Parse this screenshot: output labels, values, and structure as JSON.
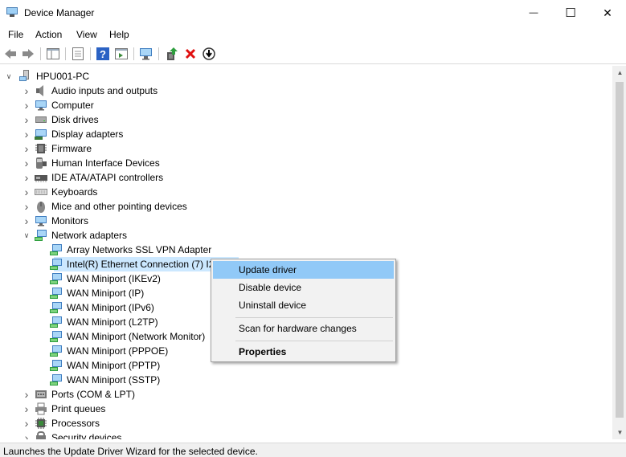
{
  "window": {
    "title": "Device Manager",
    "minimize_glyph": "—",
    "maximize_glyph": "☐",
    "close_glyph": "✕"
  },
  "menu": [
    "File",
    "Action",
    "View",
    "Help"
  ],
  "toolbar": {
    "buttons": [
      "back-icon",
      "forward-icon",
      "show-hide-tree-icon",
      "properties-icon",
      "help-icon",
      "action-pane-icon",
      "scan-hardware-icon",
      "update-driver-icon",
      "uninstall-icon",
      "disable-icon"
    ]
  },
  "tree": {
    "root": "HPU001-PC",
    "categories": [
      "Audio inputs and outputs",
      "Computer",
      "Disk drives",
      "Display adapters",
      "Firmware",
      "Human Interface Devices",
      "IDE ATA/ATAPI controllers",
      "Keyboards",
      "Mice and other pointing devices",
      "Monitors",
      "Network adapters"
    ],
    "network_adapters": [
      "Array Networks SSL VPN Adapter",
      "Intel(R) Ethernet Connection (7) I2",
      "WAN Miniport (IKEv2)",
      "WAN Miniport (IP)",
      "WAN Miniport (IPv6)",
      "WAN Miniport (L2TP)",
      "WAN Miniport (Network Monitor)",
      "WAN Miniport (PPPOE)",
      "WAN Miniport (PPTP)",
      "WAN Miniport (SSTP)"
    ],
    "after": [
      "Ports (COM & LPT)",
      "Print queues",
      "Processors",
      "Security devices"
    ]
  },
  "context_menu": {
    "update": "Update driver",
    "disable": "Disable device",
    "uninstall": "Uninstall device",
    "scan": "Scan for hardware changes",
    "properties": "Properties"
  },
  "status": "Launches the Update Driver Wizard for the selected device.",
  "colors": {
    "selection": "#cce8ff",
    "menu_hover": "#91c9f7",
    "accent": "#0078d7"
  }
}
